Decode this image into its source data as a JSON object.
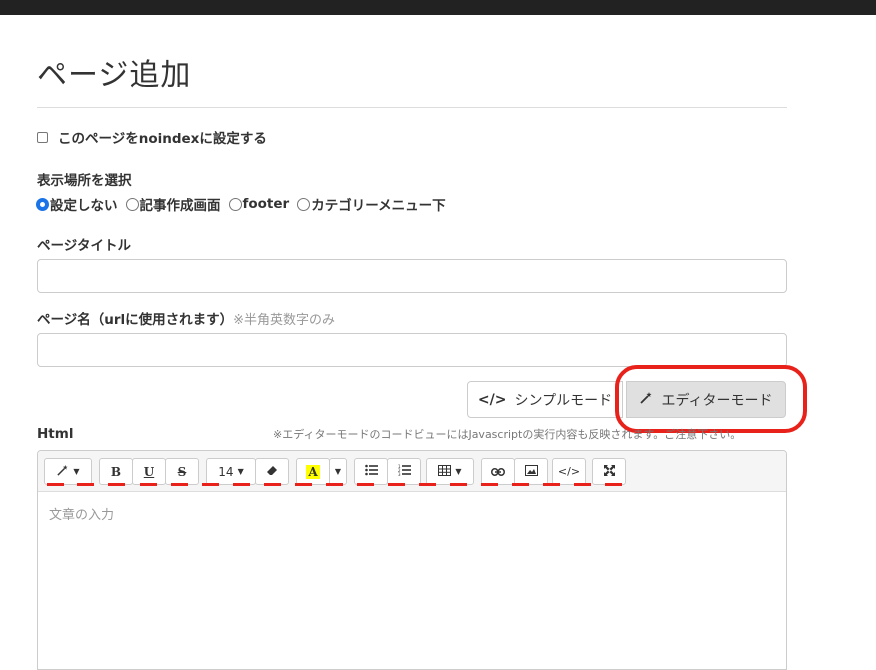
{
  "page": {
    "title": "ページ追加",
    "noindex_label": "このページをnoindexに設定する",
    "location_label": "表示場所を選択",
    "location_options": [
      "設定しない",
      "記事作成画面",
      "footer",
      "カテゴリーメニュー下"
    ],
    "location_selected": "設定しない",
    "page_title_label": "ページタイトル",
    "page_title_value": "",
    "page_name_label": "ページ名（urlに使用されます）",
    "page_name_hint": "※半角英数字のみ",
    "page_name_value": "",
    "mode_simple_label": "シンプルモード",
    "mode_editor_label": "エディターモード",
    "html_label": "Html",
    "editor_notice": "※エディターモードのコードビューにはJavascriptの実行内容も反映されます。ご注意下さい。",
    "editor_placeholder": "文章の入力",
    "toolbar": {
      "style_icon": "magic-wand-icon",
      "bold": "B",
      "underline": "U",
      "strike": "S",
      "font_size": "14",
      "eraser": "eraser-icon",
      "color_letter": "A",
      "ul": "unordered-list-icon",
      "ol": "ordered-list-icon",
      "table": "table-icon",
      "link": "link-icon",
      "image": "image-icon",
      "code": "</>",
      "fullscreen": "fullscreen-icon"
    }
  },
  "colors": {
    "highlight_red": "#e8221b",
    "radio_blue": "#1a73e8",
    "topbar": "#222222"
  }
}
